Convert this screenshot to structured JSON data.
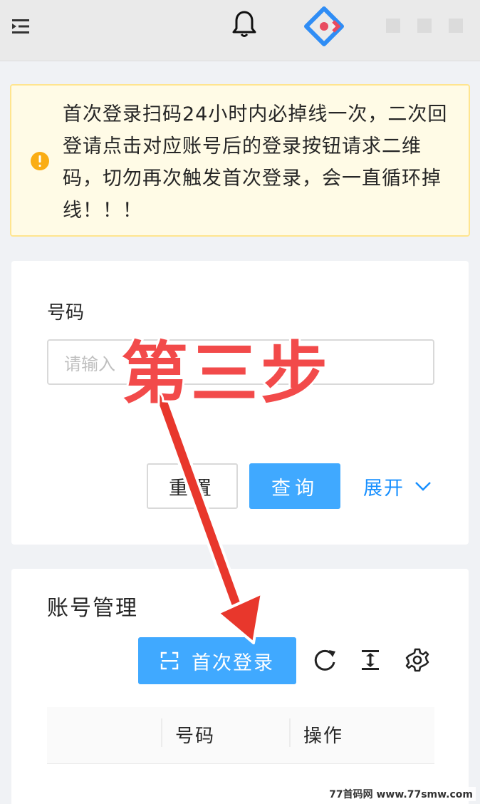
{
  "alert": {
    "message": "首次登录扫码24小时内必掉线一次，二次回登请点击对应账号后的登录按钮请求二维码，切勿再次触发首次登录，会一直循环掉线！！！"
  },
  "search": {
    "field_label": "号码",
    "placeholder": "请输入",
    "reset_label": "重置",
    "query_label": "查询",
    "expand_label": "展开"
  },
  "accounts": {
    "title": "账号管理",
    "first_login_label": "首次登录",
    "columns": [
      "号码",
      "操作"
    ]
  },
  "annotation": {
    "step_text": "第三步"
  },
  "watermark": "77首码网 www.77smw.com",
  "colors": {
    "primary": "#40a9ff",
    "link": "#1890ff",
    "alert_bg": "#fffbe6",
    "alert_border": "#ffe58f",
    "annotation_red": "#f24a4a"
  },
  "icons": {
    "menu": "menu-fold-icon",
    "bell": "bell-icon",
    "logo": "react-logo-icon",
    "warning": "exclamation-circle-icon",
    "scan": "scan-icon",
    "reload": "reload-icon",
    "column_height": "column-height-icon",
    "settings": "gear-icon",
    "expand": "chevron-down-icon"
  }
}
